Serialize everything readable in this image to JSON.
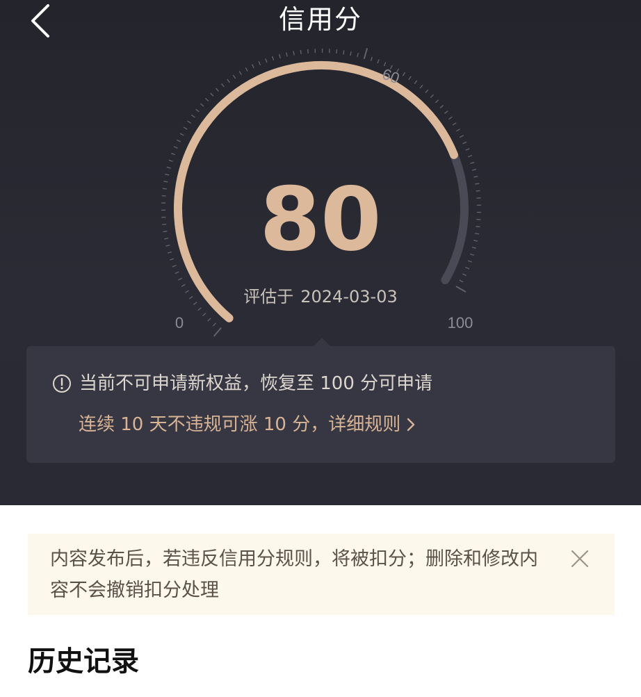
{
  "header": {
    "title": "信用分",
    "back_icon": "chevron-left-icon"
  },
  "gauge": {
    "min_label": "0",
    "max_label": "100",
    "mid_label": "60",
    "score": "80",
    "score_fraction": 0.8,
    "eval_label": "评估于",
    "eval_date": "2024-03-03",
    "colors": {
      "active": "#dcb99a",
      "inactive": "#4a4a56",
      "ticks": "#62626e"
    }
  },
  "info": {
    "warning_icon": "info-circle-icon",
    "line1": "当前不可申请新权益，恢复至 100 分可申请",
    "line2": "连续 10 天不违规可涨 10 分，详细规则",
    "link_icon": "chevron-right-icon"
  },
  "notice": {
    "text": "内容发布后，若违反信用分规则，将被扣分；删除和修改内容不会撤销扣分处理",
    "close_icon": "close-icon"
  },
  "history": {
    "title": "历史记录"
  }
}
